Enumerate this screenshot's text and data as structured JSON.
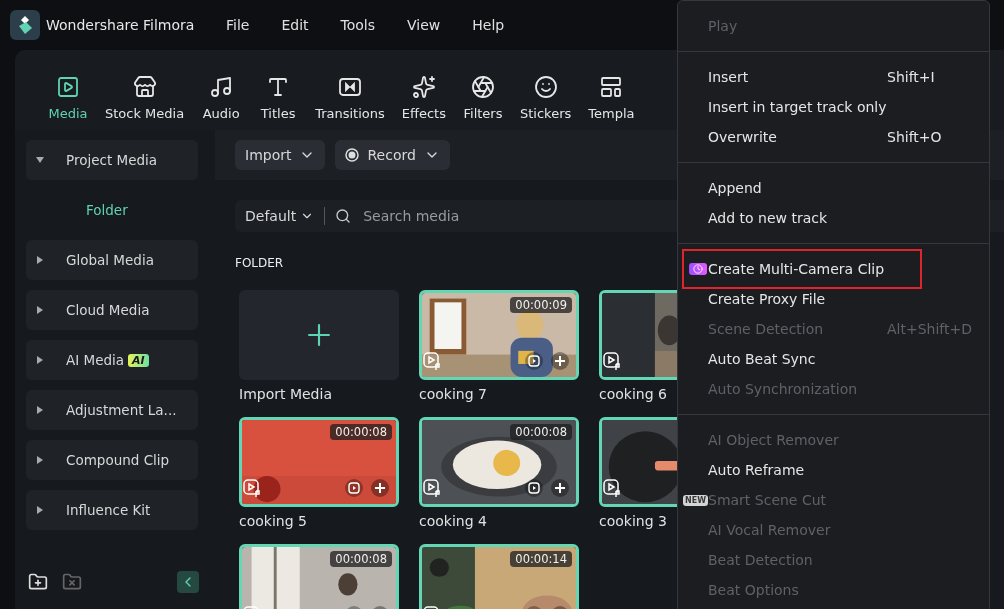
{
  "app": {
    "title": "Wondershare Filmora"
  },
  "menubar": [
    "File",
    "Edit",
    "Tools",
    "View",
    "Help"
  ],
  "toolbar": [
    {
      "label": "Media",
      "kind": "media",
      "selected": true
    },
    {
      "label": "Stock Media",
      "kind": "stock",
      "selected": false
    },
    {
      "label": "Audio",
      "kind": "audio",
      "selected": false
    },
    {
      "label": "Titles",
      "kind": "titles",
      "selected": false
    },
    {
      "label": "Transitions",
      "kind": "transitions",
      "selected": false
    },
    {
      "label": "Effects",
      "kind": "effects",
      "selected": false
    },
    {
      "label": "Filters",
      "kind": "filters",
      "selected": false
    },
    {
      "label": "Stickers",
      "kind": "stickers",
      "selected": false
    },
    {
      "label": "Templa",
      "kind": "templates",
      "selected": false
    }
  ],
  "sidebar": {
    "items": [
      {
        "label": "Project Media",
        "expanded": true,
        "children": [
          {
            "label": "Folder",
            "selected": true
          }
        ]
      },
      {
        "label": "Global Media",
        "expanded": false
      },
      {
        "label": "Cloud Media",
        "expanded": false
      },
      {
        "label": "AI Media",
        "badge": "AI",
        "expanded": false
      },
      {
        "label": "Adjustment La...",
        "expanded": false
      },
      {
        "label": "Compound Clip",
        "expanded": false
      },
      {
        "label": "Influence Kit",
        "expanded": false
      }
    ]
  },
  "media": {
    "import_button": "Import",
    "record_button": "Record",
    "sort": "Default",
    "search": {
      "placeholder": "Search media"
    },
    "section": "FOLDER",
    "tiles": [
      {
        "kind": "import",
        "label": "Import Media"
      },
      {
        "kind": "clip",
        "label": "cooking 7",
        "duration": "00:00:09"
      },
      {
        "kind": "clip",
        "label": "cooking 6"
      },
      {
        "kind": "clip",
        "label": "cooking 5",
        "duration": "00:00:08"
      },
      {
        "kind": "clip",
        "label": "cooking 4",
        "duration": "00:00:08"
      },
      {
        "kind": "clip",
        "label": "cooking 3"
      },
      {
        "kind": "clip",
        "duration": "00:00:08"
      },
      {
        "kind": "clip",
        "duration": "00:00:14"
      }
    ]
  },
  "context_menu": [
    {
      "kind": "item",
      "label": "Play",
      "disabled": true
    },
    {
      "kind": "separator"
    },
    {
      "kind": "item",
      "label": "Insert",
      "shortcut": "Shift+I",
      "disabled": false
    },
    {
      "kind": "item",
      "label": "Insert in target track only",
      "disabled": false
    },
    {
      "kind": "item",
      "label": "Overwrite",
      "shortcut": "Shift+O",
      "disabled": false
    },
    {
      "kind": "separator"
    },
    {
      "kind": "item",
      "label": "Append",
      "disabled": false
    },
    {
      "kind": "item",
      "label": "Add to new track",
      "disabled": false
    },
    {
      "kind": "separator"
    },
    {
      "kind": "icon_item",
      "label": "Create Multi-Camera Clip",
      "disabled": false,
      "highlighted": true
    },
    {
      "kind": "item",
      "label": "Create Proxy File",
      "disabled": false
    },
    {
      "kind": "item",
      "label": "Scene Detection",
      "shortcut": "Alt+Shift+D",
      "disabled": true
    },
    {
      "kind": "item",
      "label": "Auto Beat Sync",
      "disabled": false
    },
    {
      "kind": "item",
      "label": "Auto Synchronization",
      "disabled": true
    },
    {
      "kind": "separator"
    },
    {
      "kind": "item",
      "label": "AI Object Remover",
      "disabled": true
    },
    {
      "kind": "item",
      "label": "Auto Reframe",
      "disabled": false
    },
    {
      "kind": "item",
      "label": "Smart Scene Cut",
      "disabled": true,
      "badge": "NEW"
    },
    {
      "kind": "item",
      "label": "AI Vocal Remover",
      "disabled": true
    },
    {
      "kind": "item",
      "label": "Beat Detection",
      "disabled": true
    },
    {
      "kind": "item",
      "label": "Beat Options",
      "disabled": true
    }
  ]
}
